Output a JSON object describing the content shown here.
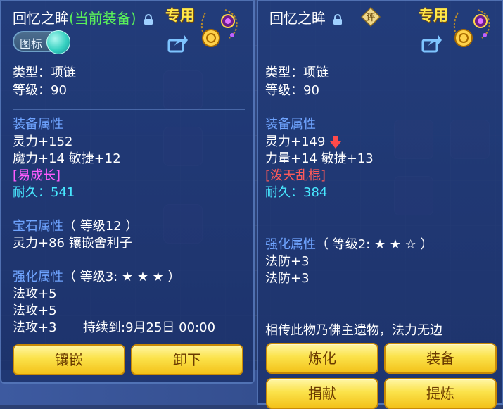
{
  "left": {
    "title": "回忆之眸",
    "title_tag": "(当前装备)",
    "exclusive": "专用",
    "toggle_label": "图标",
    "type_line": "类型：项链",
    "level_line": "等级：90",
    "equip_attr_title": "装备属性",
    "attrs": [
      "灵力+152",
      "魔力+14 敏捷+12"
    ],
    "special": "[易成长]",
    "durability_label": "耐久：",
    "durability_value": "541",
    "gem_title": "宝石属性",
    "gem_level": "（ 等级12 ）",
    "gem_line": "灵力+86 镶嵌舍利子",
    "enhance_title": "强化属性",
    "enhance_level": "（ 等级3: ★ ★ ★ ）",
    "enhance_lines": [
      "法攻+5",
      "法攻+5",
      "法攻+3"
    ],
    "duration": "持续到:9月25日 00:00",
    "buttons": [
      "镶嵌",
      "卸下"
    ]
  },
  "right": {
    "title": "回忆之眸",
    "rate_badge": "评",
    "exclusive": "专用",
    "type_line": "类型：项链",
    "level_line": "等级：90",
    "equip_attr_title": "装备属性",
    "attrs": [
      "灵力+149",
      "力量+14 敏捷+13"
    ],
    "special": "[泼天乱棍]",
    "durability_label": "耐久：",
    "durability_value": "384",
    "enhance_title": "强化属性",
    "enhance_level": "（ 等级2: ★ ★ ☆ ）",
    "enhance_lines": [
      "法防+3",
      "法防+3"
    ],
    "legend": "相传此物乃佛主遗物，法力无边",
    "buttons": [
      "炼化",
      "装备",
      "捐献",
      "提炼"
    ]
  },
  "colors": {
    "panel": "#203a78",
    "section": "#6fa4ff",
    "green": "#59f05a",
    "purple": "#ff5cff",
    "red": "#ff5a5a",
    "cyan": "#48e8ff",
    "gold": "#ffe84a",
    "button": "#fbe24a"
  },
  "icons": [
    "lock-icon",
    "necklace-icon",
    "share-icon",
    "arrow-down-icon",
    "rate-icon"
  ]
}
